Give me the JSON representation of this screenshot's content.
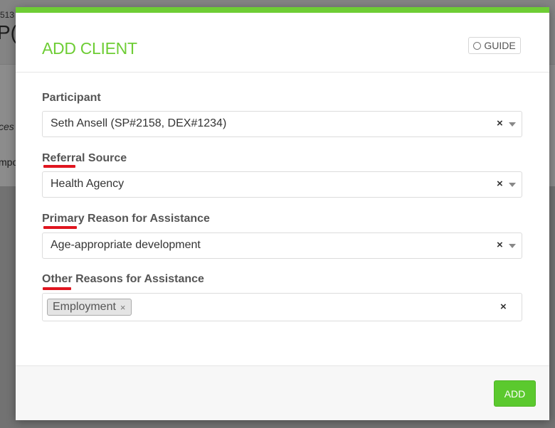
{
  "background": {
    "id_fragment": "513",
    "title_fragment": "P(",
    "text_fragment_1": "ces",
    "text_fragment_2": "mpo"
  },
  "modal": {
    "title": "ADD CLIENT",
    "guide_label": "GUIDE",
    "accent_color": "#6ecd35",
    "fields": {
      "participant": {
        "label": "Participant",
        "value": "Seth Ansell (SP#2158, DEX#1234)"
      },
      "referral_source": {
        "label": "Referral Source",
        "value": "Health Agency"
      },
      "primary_reason": {
        "label": "Primary Reason for Assistance",
        "value": "Age-appropriate development"
      },
      "other_reasons": {
        "label": "Other Reasons for Assistance",
        "tags": [
          "Employment"
        ]
      }
    },
    "clear_symbol": "×",
    "add_label": "ADD"
  }
}
